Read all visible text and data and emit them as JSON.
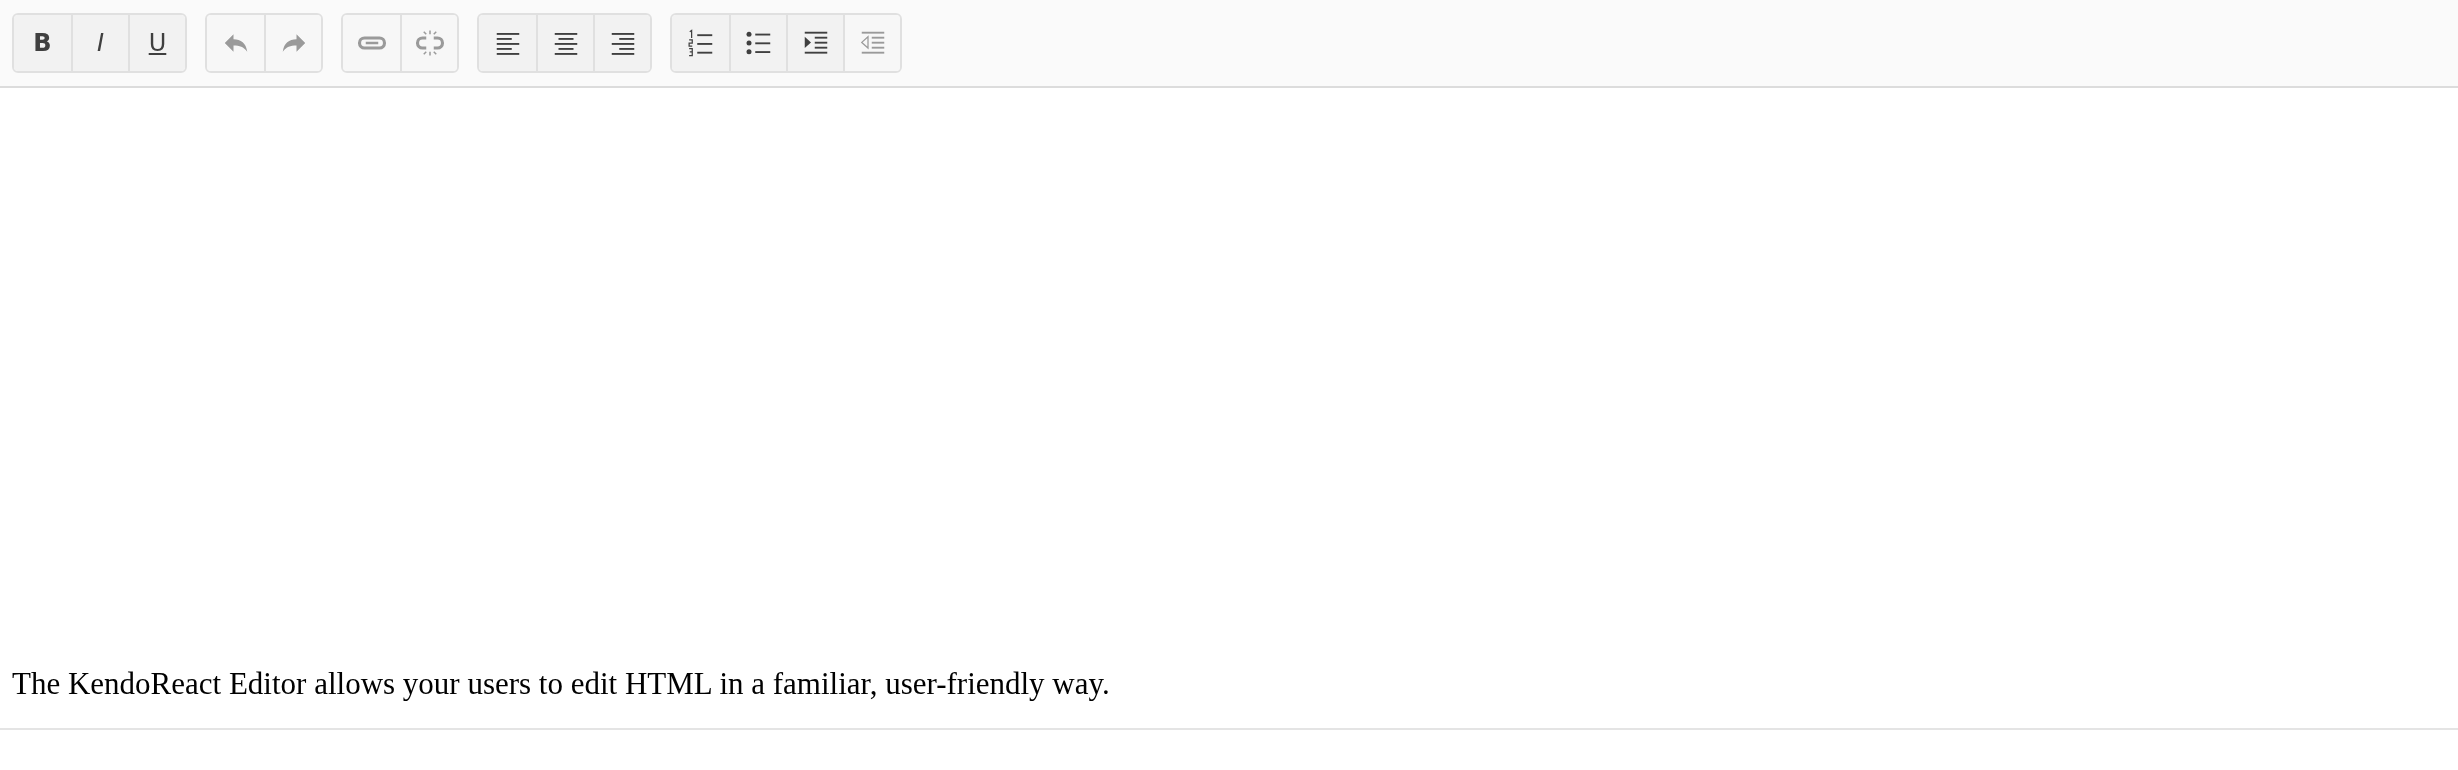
{
  "toolbar": {
    "groups": [
      {
        "buttons": [
          {
            "kind": "bold",
            "label": "B",
            "disabled": false
          },
          {
            "kind": "italic",
            "label": "I",
            "disabled": false
          },
          {
            "kind": "underline",
            "label": "U",
            "disabled": false
          }
        ]
      },
      {
        "buttons": [
          {
            "kind": "undo",
            "disabled": true
          },
          {
            "kind": "redo",
            "disabled": true
          }
        ]
      },
      {
        "buttons": [
          {
            "kind": "link",
            "disabled": true
          },
          {
            "kind": "unlink",
            "disabled": true
          }
        ]
      },
      {
        "buttons": [
          {
            "kind": "align-left",
            "disabled": false
          },
          {
            "kind": "align-center",
            "disabled": false
          },
          {
            "kind": "align-right",
            "disabled": false
          }
        ]
      },
      {
        "buttons": [
          {
            "kind": "ordered-list",
            "disabled": false
          },
          {
            "kind": "bullet-list",
            "disabled": false
          },
          {
            "kind": "indent",
            "disabled": false
          },
          {
            "kind": "outdent",
            "disabled": true
          }
        ]
      }
    ]
  },
  "content": {
    "paragraphs": [
      "The KendoReact Editor allows your users to edit HTML in a familiar, user-friendly way."
    ]
  }
}
